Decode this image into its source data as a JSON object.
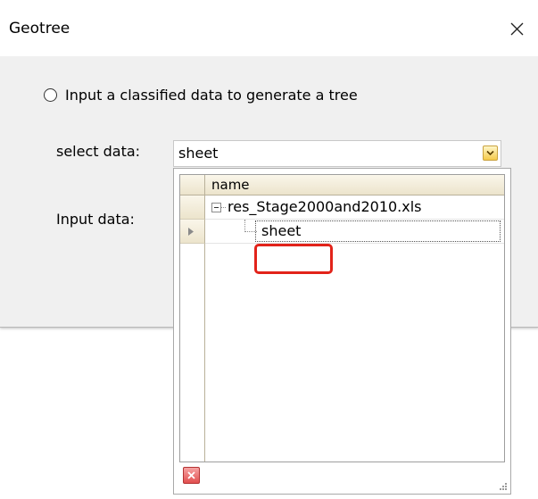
{
  "window": {
    "title": "Geotree",
    "close_icon": "close-icon"
  },
  "options": {
    "classified_label": "Input a classified data to generate a tree"
  },
  "form": {
    "select_label": "select data:",
    "select_value": "sheet",
    "input_label": "Input data:"
  },
  "dropdown": {
    "column_header": "name",
    "tree": {
      "root": "res_Stage2000and2010.xls",
      "child": "sheet"
    },
    "clear_icon": "clear-icon"
  },
  "colors": {
    "highlight": "#e2231a",
    "header_bg": "#ece4cc",
    "dropdown_arrow": "#f5c94a"
  }
}
